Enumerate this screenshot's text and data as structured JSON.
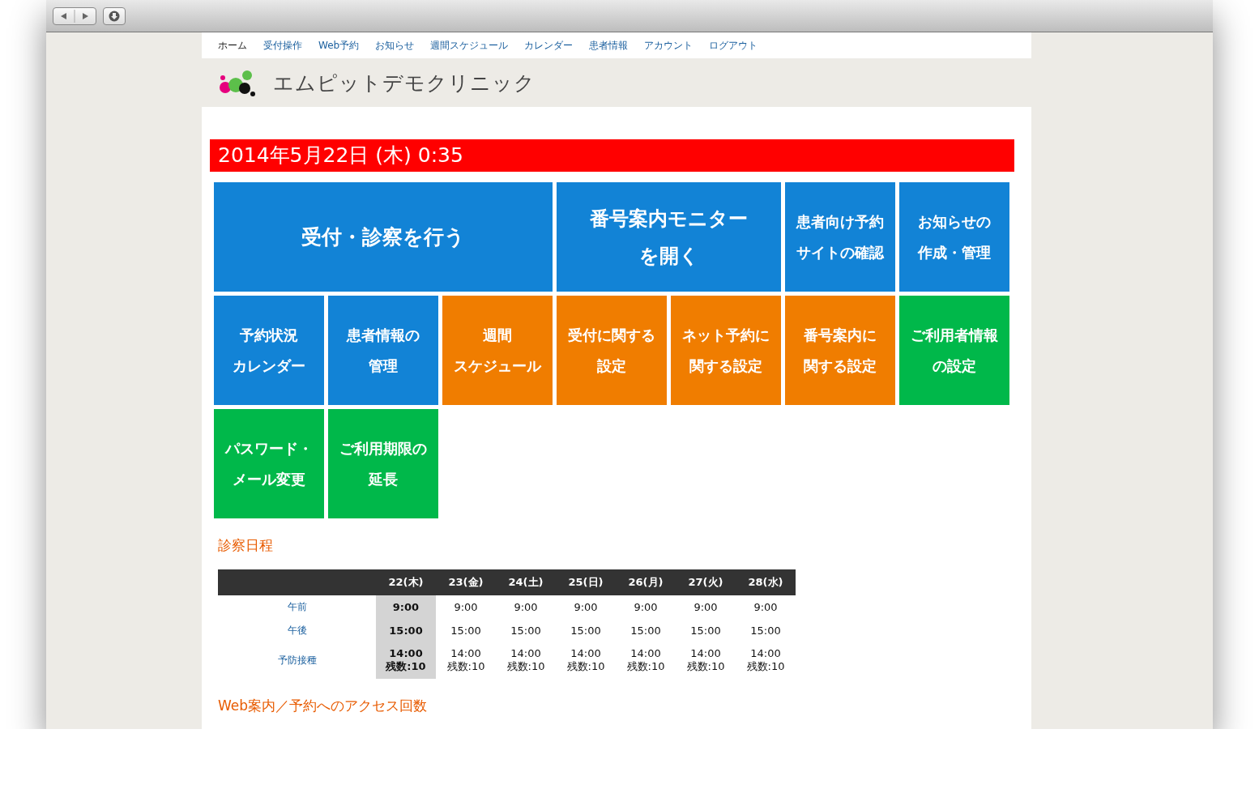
{
  "nav": [
    {
      "label": "ホーム",
      "selected": true
    },
    {
      "label": "受付操作",
      "selected": false
    },
    {
      "label": "Web予約",
      "selected": false
    },
    {
      "label": "お知らせ",
      "selected": false
    },
    {
      "label": "週間スケジュール",
      "selected": false
    },
    {
      "label": "カレンダー",
      "selected": false
    },
    {
      "label": "患者情報",
      "selected": false
    },
    {
      "label": "アカウント",
      "selected": false
    },
    {
      "label": "ログアウト",
      "selected": false
    }
  ],
  "clinic_name": "エムピットデモクリニック",
  "date_banner": "2014年5月22日 (木) 0:35",
  "tiles": [
    {
      "kind": "large",
      "color": "#1283d6",
      "lines": [
        "受付・診察を行う"
      ]
    },
    {
      "kind": "medium",
      "color": "#1283d6",
      "lines": [
        "番号案内モニター",
        "を開く"
      ]
    },
    {
      "kind": "small",
      "color": "#1283d6",
      "lines": [
        "患者向け予約",
        "サイトの確認"
      ]
    },
    {
      "kind": "small",
      "color": "#1283d6",
      "lines": [
        "お知らせの",
        "作成・管理"
      ]
    },
    {
      "kind": "small",
      "color": "#1283d6",
      "lines": [
        "予約状況",
        "カレンダー"
      ]
    },
    {
      "kind": "small",
      "color": "#1283d6",
      "lines": [
        "患者情報の",
        "管理"
      ]
    },
    {
      "kind": "small",
      "color": "#f07d00",
      "lines": [
        "週間",
        "スケジュール"
      ]
    },
    {
      "kind": "small",
      "color": "#f07d00",
      "lines": [
        "受付に関する",
        "設定"
      ]
    },
    {
      "kind": "small",
      "color": "#f07d00",
      "lines": [
        "ネット予約に",
        "関する設定"
      ]
    },
    {
      "kind": "small",
      "color": "#f07d00",
      "lines": [
        "番号案内に",
        "関する設定"
      ]
    },
    {
      "kind": "small",
      "color": "#00b84a",
      "lines": [
        "ご利用者情報",
        "の設定"
      ]
    },
    {
      "kind": "small",
      "color": "#00b84a",
      "lines": [
        "パスワード・",
        "メール変更"
      ]
    },
    {
      "kind": "small",
      "color": "#00b84a",
      "lines": [
        "ご利用期限の",
        "延長"
      ]
    }
  ],
  "schedule": {
    "title": "診察日程",
    "columns": [
      {
        "label": "22(木)",
        "selected": true
      },
      {
        "label": "23(金)",
        "selected": false
      },
      {
        "label": "24(土)",
        "selected": false
      },
      {
        "label": "25(日)",
        "selected": false
      },
      {
        "label": "26(月)",
        "selected": false
      },
      {
        "label": "27(火)",
        "selected": false
      },
      {
        "label": "28(水)",
        "selected": false
      }
    ],
    "rows": [
      {
        "label": "午前",
        "cells": [
          [
            "9:00"
          ],
          [
            "9:00"
          ],
          [
            "9:00"
          ],
          [
            "9:00"
          ],
          [
            "9:00"
          ],
          [
            "9:00"
          ],
          [
            "9:00"
          ]
        ]
      },
      {
        "label": "午後",
        "cells": [
          [
            "15:00"
          ],
          [
            "15:00"
          ],
          [
            "15:00"
          ],
          [
            "15:00"
          ],
          [
            "15:00"
          ],
          [
            "15:00"
          ],
          [
            "15:00"
          ]
        ]
      },
      {
        "label": "予防接種",
        "cells": [
          [
            "14:00",
            "残数:10"
          ],
          [
            "14:00",
            "残数:10"
          ],
          [
            "14:00",
            "残数:10"
          ],
          [
            "14:00",
            "残数:10"
          ],
          [
            "14:00",
            "残数:10"
          ],
          [
            "14:00",
            "残数:10"
          ],
          [
            "14:00",
            "残数:10"
          ]
        ]
      }
    ]
  },
  "access_title": "Web案内／予約へのアクセス回数"
}
